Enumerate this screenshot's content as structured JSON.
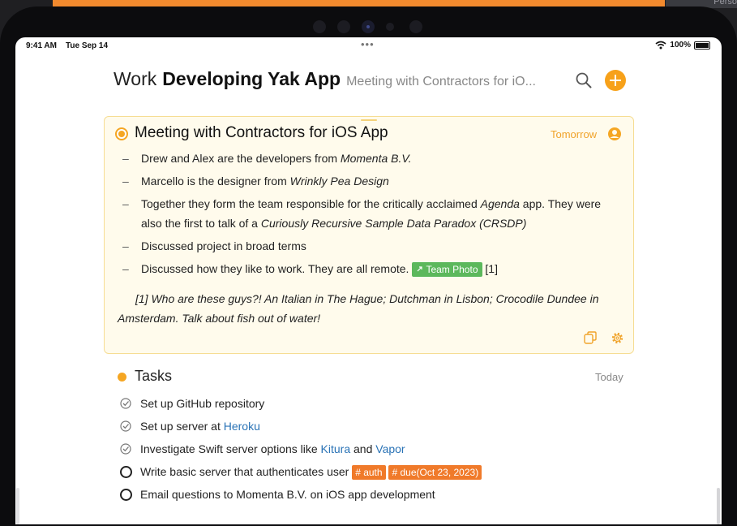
{
  "device": {
    "corner_label": "Perso"
  },
  "status_bar": {
    "time": "9:41 AM",
    "date": "Tue Sep 14",
    "center_dots": "•••",
    "battery": "100%"
  },
  "header": {
    "area": "Work",
    "project": "Developing Yak App",
    "note": "Meeting with Contractors for iO..."
  },
  "note_card": {
    "title": "Meeting with Contractors for iOS App",
    "date": "Tomorrow",
    "bullets": {
      "b1_text": "Drew and Alex are the developers from ",
      "b1_italic": "Momenta B.V.",
      "b2_text": "Marcello is the designer from ",
      "b2_italic": "Wrinkly Pea Design",
      "b3_text1": "Together they form the team responsible for the critically acclaimed ",
      "b3_italic1": "Agenda",
      "b3_text2": " app. They were also the first to talk of a ",
      "b3_italic2": "Curiously Recursive Sample Data Paradox (CRSDP)",
      "b4_text": "Discussed project in broad terms",
      "b5_text": "Discussed how they like to work. They are all remote.",
      "b5_tag": "Team Photo",
      "b5_ref": "[1]"
    },
    "footnote": "[1] Who are these guys?! An Italian in The Hague; Dutchman in Lisbon; Crocodile Dundee in Amsterdam. Talk about fish out of water!"
  },
  "tasks": {
    "title": "Tasks",
    "date": "Today",
    "t1": "Set up GitHub repository",
    "t2_text": "Set up server at ",
    "t2_link": "Heroku",
    "t3_text": "Investigate Swift server options like ",
    "t3_link1": "Kitura",
    "t3_and": " and ",
    "t3_link2": "Vapor",
    "t4_text": "Write basic server that authenticates user",
    "t4_tag1": "# auth",
    "t4_tag2": "# due(Oct 23, 2023)",
    "t5_text": "Email questions to Momenta B.V. on iOS app development"
  },
  "colors": {
    "accent": "#f5a623",
    "tag_orange": "#f07a2a",
    "tag_green": "#5cb85c",
    "link": "#2a73b6",
    "card_bg": "#fffbec"
  }
}
